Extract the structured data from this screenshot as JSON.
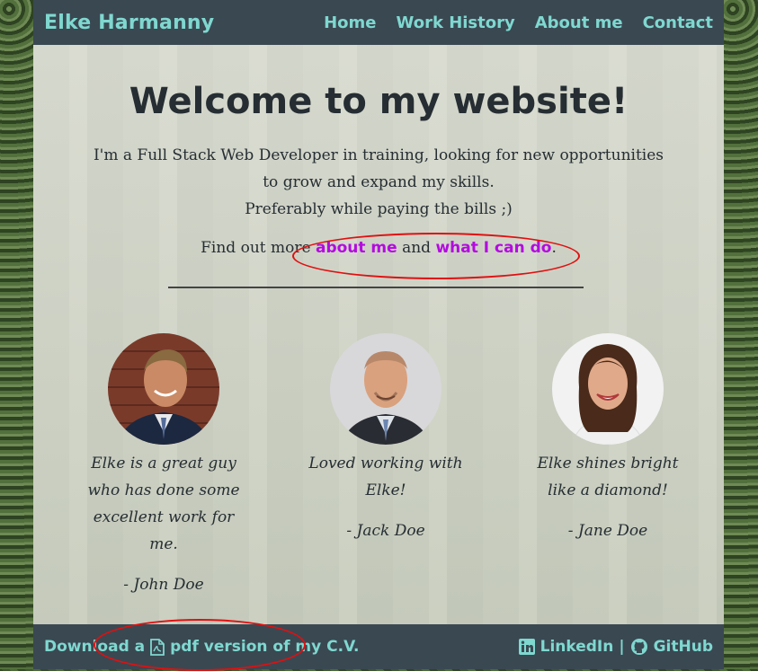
{
  "nav": {
    "brand": "Elke Harmanny",
    "links": [
      "Home",
      "Work History",
      "About me",
      "Contact"
    ]
  },
  "hero": {
    "title": "Welcome to my website!",
    "intro_line1": "I'm a Full Stack Web Developer in training, looking for new opportunities",
    "intro_line2": "to grow and expand my skills.",
    "intro_line3": "Preferably while paying the bills ;)",
    "find_prefix": "Find out more",
    "about_link": "about me",
    "find_and": "and",
    "what_link": "what I can do",
    "find_suffix": "."
  },
  "testimonials": [
    {
      "quote": "Elke is a great guy who has done some excellent work for me.",
      "author": "- John Doe"
    },
    {
      "quote": "Loved working with Elke!",
      "author": "- Jack Doe"
    },
    {
      "quote": "Elke shines bright like a diamond!",
      "author": "- Jane Doe"
    }
  ],
  "footer": {
    "download_prefix": "Download a",
    "download_link": "pdf version of my C.V.",
    "linkedin": "LinkedIn",
    "separator": "|",
    "github": "GitHub"
  },
  "colors": {
    "accent": "#7fd8d0",
    "nav_bg": "#3a4852",
    "link": "#b40ae0",
    "annotation": "#e01010"
  }
}
